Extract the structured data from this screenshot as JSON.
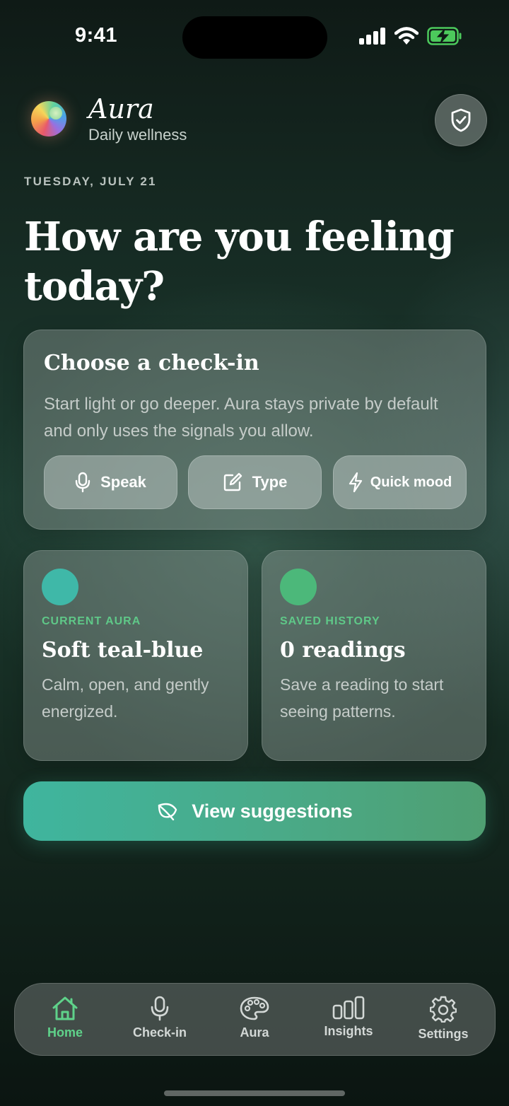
{
  "status_bar": {
    "time": "9:41"
  },
  "header": {
    "app_name": "Aura",
    "subtitle": "Daily wellness",
    "privacy_icon": "shield-check-icon"
  },
  "date": "TUESDAY, JULY 21",
  "headline": "How are you feeling today?",
  "checkin": {
    "title": "Choose a check-in",
    "description": "Start light or go deeper. Aura stays private by default and only uses the signals you allow.",
    "options": [
      {
        "label": "Speak",
        "icon": "microphone-icon"
      },
      {
        "label": "Type",
        "icon": "edit-icon"
      },
      {
        "label": "Quick mood",
        "icon": "lightning-icon"
      }
    ]
  },
  "current_aura": {
    "label": "CURRENT AURA",
    "value": "Soft teal-blue",
    "description": "Calm, open, and gently energized.",
    "color": "#3fb8a8"
  },
  "saved_history": {
    "label": "SAVED HISTORY",
    "value": "0 readings",
    "description": "Save a reading to start seeing patterns.",
    "color": "#4cb87a"
  },
  "cta": {
    "label": "View suggestions",
    "icon": "leaf-icon"
  },
  "tabs": [
    {
      "label": "Home",
      "icon": "home-icon",
      "active": true
    },
    {
      "label": "Check-in",
      "icon": "microphone-icon",
      "active": false
    },
    {
      "label": "Aura",
      "icon": "palette-icon",
      "active": false
    },
    {
      "label": "Insights",
      "icon": "bar-chart-icon",
      "active": false
    },
    {
      "label": "Settings",
      "icon": "gear-icon",
      "active": false
    }
  ],
  "colors": {
    "accent": "#5fd28a",
    "cta_start": "#3fb59e",
    "cta_end": "#4f9f72"
  }
}
